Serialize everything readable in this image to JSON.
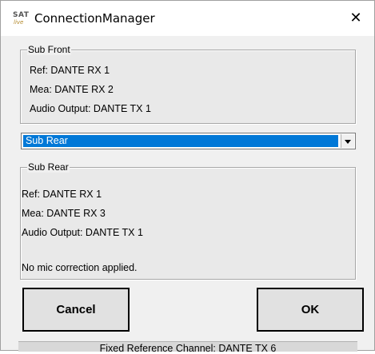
{
  "window": {
    "title": "ConnectionManager",
    "icon_text_top": "SAT",
    "icon_text_bottom": "live",
    "close_glyph": "✕"
  },
  "front_group": {
    "legend": "Sub Front",
    "lines": [
      "Ref: DANTE RX 1",
      "Mea: DANTE RX 2",
      "Audio Output: DANTE TX 1"
    ]
  },
  "dropdown": {
    "selected": "Sub Rear"
  },
  "rear_group": {
    "legend": "Sub Rear",
    "lines": [
      "Ref: DANTE RX 1",
      "Mea: DANTE RX 3",
      "Audio Output: DANTE TX 1",
      "No mic correction applied."
    ]
  },
  "buttons": {
    "cancel": "Cancel",
    "ok": "OK"
  },
  "status": {
    "text": "Fixed Reference Channel: DANTE TX 6"
  },
  "colors": {
    "selection": "#0078d7",
    "dialog_bg": "#f0f0f0"
  }
}
